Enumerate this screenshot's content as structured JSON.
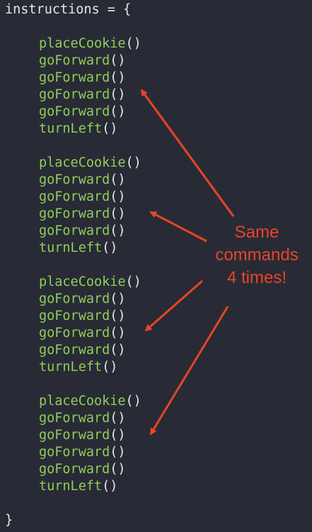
{
  "editor": {
    "header": {
      "name": "instructions",
      "op": " = {"
    },
    "footer": "}",
    "groups": [
      {
        "lines": [
          {
            "name": "placeCookie",
            "paren": "()"
          },
          {
            "name": "goForward",
            "paren": "()"
          },
          {
            "name": "goForward",
            "paren": "()"
          },
          {
            "name": "goForward",
            "paren": "()"
          },
          {
            "name": "goForward",
            "paren": "()"
          },
          {
            "name": "turnLeft",
            "paren": "()"
          }
        ]
      },
      {
        "lines": [
          {
            "name": "placeCookie",
            "paren": "()"
          },
          {
            "name": "goForward",
            "paren": "()"
          },
          {
            "name": "goForward",
            "paren": "()"
          },
          {
            "name": "goForward",
            "paren": "()"
          },
          {
            "name": "goForward",
            "paren": "()"
          },
          {
            "name": "turnLeft",
            "paren": "()"
          }
        ]
      },
      {
        "lines": [
          {
            "name": "placeCookie",
            "paren": "()"
          },
          {
            "name": "goForward",
            "paren": "()"
          },
          {
            "name": "goForward",
            "paren": "()"
          },
          {
            "name": "goForward",
            "paren": "()"
          },
          {
            "name": "goForward",
            "paren": "()"
          },
          {
            "name": "turnLeft",
            "paren": "()"
          }
        ]
      },
      {
        "lines": [
          {
            "name": "placeCookie",
            "paren": "()"
          },
          {
            "name": "goForward",
            "paren": "()"
          },
          {
            "name": "goForward",
            "paren": "()"
          },
          {
            "name": "goForward",
            "paren": "()"
          },
          {
            "name": "goForward",
            "paren": "()"
          },
          {
            "name": "turnLeft",
            "paren": "()"
          }
        ]
      }
    ]
  },
  "annotation": {
    "lines": [
      "Same",
      "commands",
      "4 times!"
    ],
    "color": "#e94327"
  },
  "colors": {
    "background": "#282b35",
    "function": "#8fce5b",
    "plain": "#e6e6e6"
  }
}
